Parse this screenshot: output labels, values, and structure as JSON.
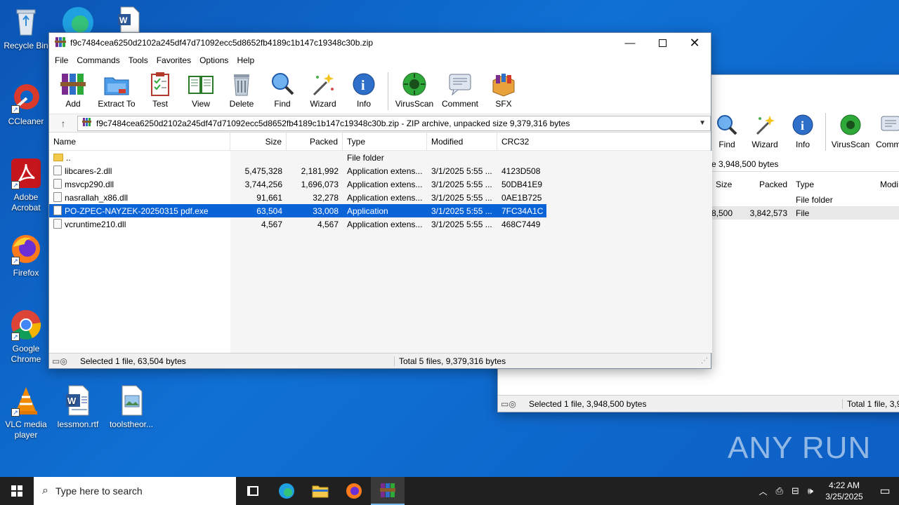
{
  "desktop": {
    "icons": [
      {
        "label": "Recycle Bin",
        "icon": "recycle-bin-icon"
      },
      {
        "label": "CCleaner",
        "icon": "ccleaner-icon"
      },
      {
        "label": "Adobe Acrobat",
        "icon": "acrobat-icon"
      },
      {
        "label": "Firefox",
        "icon": "firefox-icon"
      },
      {
        "label": "Google Chrome",
        "icon": "chrome-icon"
      },
      {
        "label": "VLC media player",
        "icon": "vlc-icon"
      },
      {
        "label": "lessmon.rtf",
        "icon": "word-document-icon"
      },
      {
        "label": "toolstheor...",
        "icon": "image-file-icon"
      }
    ],
    "watermark": "ANY RUN"
  },
  "back_window": {
    "toolbar": [
      "Find",
      "Wizard",
      "Info",
      "VirusScan",
      "Comme"
    ],
    "address": "e 3,948,500 bytes",
    "columns": [
      "Size",
      "Packed",
      "Type",
      "Modi"
    ],
    "rows": [
      {
        "size": "",
        "packed": "",
        "type": "File folder"
      },
      {
        "size": "8,500",
        "packed": "3,842,573",
        "type": "File"
      }
    ],
    "status_left": "Selected 1 file, 3,948,500 bytes",
    "status_right": "Total 1 file, 3,9"
  },
  "main_window": {
    "title": "f9c7484cea6250d2102a245df47d71092ecc5d8652fb4189c1b147c19348c30b.zip",
    "menu": [
      "File",
      "Commands",
      "Tools",
      "Favorites",
      "Options",
      "Help"
    ],
    "toolbar": [
      {
        "label": "Add",
        "icon": "add-archive-icon"
      },
      {
        "label": "Extract To",
        "icon": "extract-folder-icon"
      },
      {
        "label": "Test",
        "icon": "test-clipboard-icon"
      },
      {
        "label": "View",
        "icon": "view-book-icon"
      },
      {
        "label": "Delete",
        "icon": "trash-icon"
      },
      {
        "label": "Find",
        "icon": "magnifier-icon"
      },
      {
        "label": "Wizard",
        "icon": "wand-icon"
      },
      {
        "label": "Info",
        "icon": "info-icon"
      },
      {
        "label": "VirusScan",
        "icon": "virus-scan-icon"
      },
      {
        "label": "Comment",
        "icon": "comment-icon"
      },
      {
        "label": "SFX",
        "icon": "sfx-box-icon"
      }
    ],
    "address": "f9c7484cea6250d2102a245df47d71092ecc5d8652fb4189c1b147c19348c30b.zip - ZIP archive, unpacked size 9,379,316 bytes",
    "columns": [
      "Name",
      "Size",
      "Packed",
      "Type",
      "Modified",
      "CRC32"
    ],
    "files": [
      {
        "name": "..",
        "size": "",
        "packed": "",
        "type": "File folder",
        "modified": "",
        "crc": "",
        "folder": true,
        "selected": false
      },
      {
        "name": "libcares-2.dll",
        "size": "5,475,328",
        "packed": "2,181,992",
        "type": "Application extens...",
        "modified": "3/1/2025 5:55 ...",
        "crc": "4123D508",
        "folder": false,
        "selected": false
      },
      {
        "name": "msvcp290.dll",
        "size": "3,744,256",
        "packed": "1,696,073",
        "type": "Application extens...",
        "modified": "3/1/2025 5:55 ...",
        "crc": "50DB41E9",
        "folder": false,
        "selected": false
      },
      {
        "name": "nasrallah_x86.dll",
        "size": "91,661",
        "packed": "32,278",
        "type": "Application extens...",
        "modified": "3/1/2025 5:55 ...",
        "crc": "0AE1B725",
        "folder": false,
        "selected": false
      },
      {
        "name": "PO-ZPEC-NAYZEK-20250315 pdf.exe",
        "size": "63,504",
        "packed": "33,008",
        "type": "Application",
        "modified": "3/1/2025 5:55 ...",
        "crc": "7FC34A1C",
        "folder": false,
        "selected": true
      },
      {
        "name": "vcruntime210.dll",
        "size": "4,567",
        "packed": "4,567",
        "type": "Application extens...",
        "modified": "3/1/2025 5:55 ...",
        "crc": "468C7449",
        "folder": false,
        "selected": false
      }
    ],
    "status_left": "Selected 1 file, 63,504 bytes",
    "status_right": "Total 5 files, 9,379,316 bytes"
  },
  "taskbar": {
    "search_placeholder": "Type here to search",
    "time": "4:22 AM",
    "date": "3/25/2025"
  }
}
